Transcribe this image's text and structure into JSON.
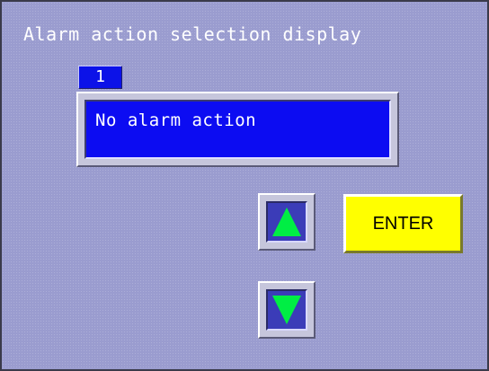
{
  "window": {
    "title": "Alarm action selection display"
  },
  "selection": {
    "index": "1",
    "value": "No alarm action"
  },
  "controls": {
    "enter_label": "ENTER",
    "up_icon": "arrow-up-icon",
    "down_icon": "arrow-down-icon"
  },
  "colors": {
    "background": "#9a9ccf",
    "display_blue": "#0c0cf2",
    "arrow_green": "#00ee44",
    "enter_yellow": "#ffff00"
  }
}
